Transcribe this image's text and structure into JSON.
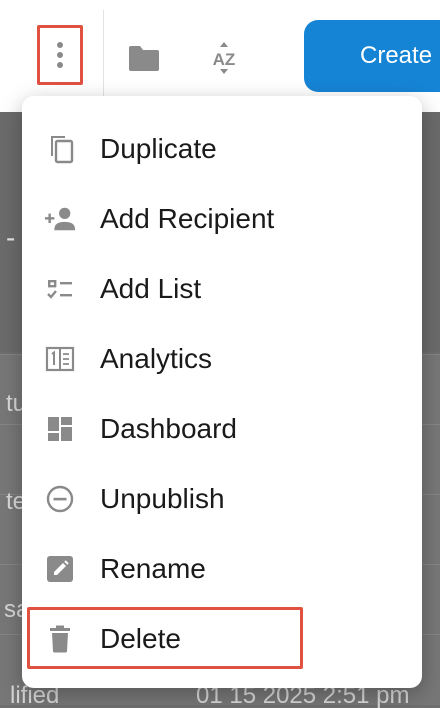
{
  "toolbar": {
    "more_button": {
      "icon": "more-vertical-icon",
      "highlighted": true
    },
    "folder_button": {
      "icon": "folder-icon"
    },
    "sort_button": {
      "icon": "sort-az-icon",
      "text": "AZ"
    },
    "create_button": {
      "label": "Create"
    }
  },
  "background": {
    "fragments": {
      "dash": "-",
      "f1": "tu",
      "f2": "te",
      "f3": "sa",
      "footer_left": "lified",
      "footer_right": "01 15 2025 2:51 pm"
    }
  },
  "menu": {
    "items": [
      {
        "label": "Duplicate",
        "icon": "duplicate-icon"
      },
      {
        "label": "Add Recipient",
        "icon": "add-person-icon"
      },
      {
        "label": "Add List",
        "icon": "checklist-icon"
      },
      {
        "label": "Analytics",
        "icon": "analytics-icon"
      },
      {
        "label": "Dashboard",
        "icon": "dashboard-icon"
      },
      {
        "label": "Unpublish",
        "icon": "minus-circle-icon"
      },
      {
        "label": "Rename",
        "icon": "pencil-icon"
      },
      {
        "label": "Delete",
        "icon": "trash-icon",
        "highlighted": true
      }
    ]
  },
  "colors": {
    "accent": "#1684d5",
    "highlight_border": "#e0523f",
    "icon_gray": "#8a8a8a",
    "overlay": "#6f6f6f"
  }
}
